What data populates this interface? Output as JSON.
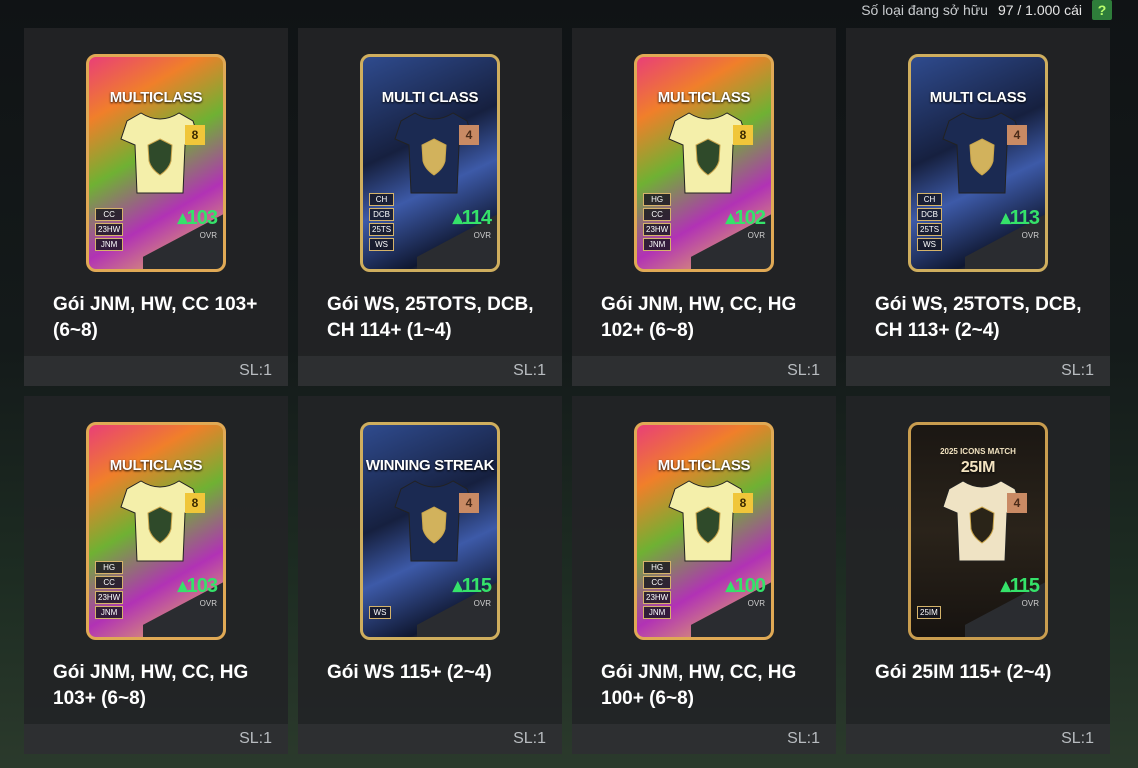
{
  "header": {
    "owned_label": "Số loại đang sở hữu",
    "owned_count": "97 / 1.000 cái",
    "help_label": "?"
  },
  "packs": [
    {
      "title": "Gói JNM, HW, CC 103+ (6~8)",
      "qty": "SL:1",
      "style": "mc",
      "card_label": "MULTICLASS",
      "card_sublabel": "",
      "badge": "8",
      "badge_color": "gold",
      "ovr": "103",
      "ovr_label": "OVR",
      "tags": [
        "CC",
        "23HW",
        "JNM"
      ]
    },
    {
      "title": "Gói WS, 25TOTS, DCB, CH 114+ (1~4)",
      "qty": "SL:1",
      "style": "ws",
      "card_label": "MULTI CLASS",
      "card_sublabel": "",
      "badge": "4",
      "badge_color": "bronze",
      "ovr": "114",
      "ovr_label": "OVR",
      "tags": [
        "CH",
        "DCB",
        "25TS",
        "WS"
      ]
    },
    {
      "title": "Gói JNM, HW, CC, HG 102+ (6~8)",
      "qty": "SL:1",
      "style": "mc",
      "card_label": "MULTICLASS",
      "card_sublabel": "",
      "badge": "8",
      "badge_color": "gold",
      "ovr": "102",
      "ovr_label": "OVR",
      "tags": [
        "HG",
        "CC",
        "23HW",
        "JNM"
      ]
    },
    {
      "title": "Gói WS, 25TOTS, DCB, CH 113+ (2~4)",
      "qty": "SL:1",
      "style": "ws",
      "card_label": "MULTI CLASS",
      "card_sublabel": "",
      "badge": "4",
      "badge_color": "bronze",
      "ovr": "113",
      "ovr_label": "OVR",
      "tags": [
        "CH",
        "DCB",
        "25TS",
        "WS"
      ]
    },
    {
      "title": "Gói JNM, HW, CC, HG 103+ (6~8)",
      "qty": "SL:1",
      "style": "mc",
      "card_label": "MULTICLASS",
      "card_sublabel": "",
      "badge": "8",
      "badge_color": "gold",
      "ovr": "103",
      "ovr_label": "OVR",
      "tags": [
        "HG",
        "CC",
        "23HW",
        "JNM"
      ]
    },
    {
      "title": "Gói WS 115+ (2~4)",
      "qty": "SL:1",
      "style": "ws",
      "card_label": "WINNING STREAK",
      "card_sublabel": "",
      "badge": "4",
      "badge_color": "bronze",
      "ovr": "115",
      "ovr_label": "OVR",
      "tags": [
        "WS"
      ]
    },
    {
      "title": "Gói JNM, HW, CC, HG 100+ (6~8)",
      "qty": "SL:1",
      "style": "mc",
      "card_label": "MULTICLASS",
      "card_sublabel": "",
      "badge": "8",
      "badge_color": "gold",
      "ovr": "100",
      "ovr_label": "OVR",
      "tags": [
        "HG",
        "CC",
        "23HW",
        "JNM"
      ]
    },
    {
      "title": "Gói 25IM 115+ (2~4)",
      "qty": "SL:1",
      "style": "im",
      "card_label": "25IM",
      "card_sublabel": "2025 ICONS MATCH",
      "badge": "4",
      "badge_color": "bronze",
      "ovr": "115",
      "ovr_label": "OVR",
      "tags": [
        "25IM"
      ]
    }
  ]
}
